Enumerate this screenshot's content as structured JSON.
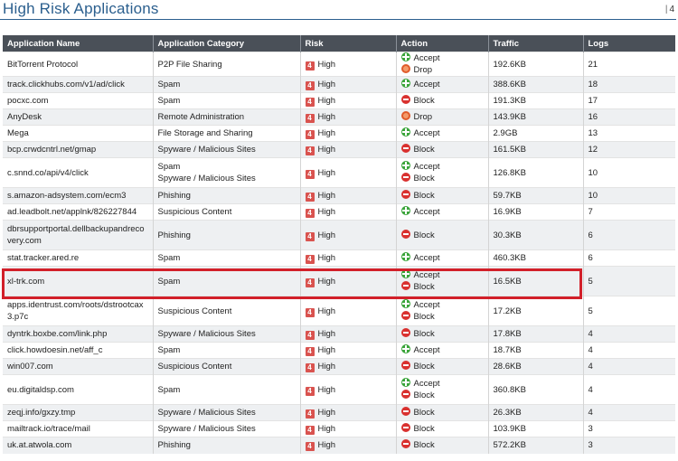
{
  "title": "High Risk Applications",
  "page_number": "4",
  "colors": {
    "title": "#2b5f8e",
    "header_bg": "#4a5058",
    "risk": "#d9534f",
    "accept": "#3aa43a",
    "drop": "#e05a2a",
    "block": "#d9312f",
    "highlight": "#d2202a"
  },
  "columns": [
    "Application Name",
    "Application Category",
    "Risk",
    "Action",
    "Traffic",
    "Logs"
  ],
  "rows": [
    {
      "name": "BitTorrent Protocol",
      "category": "P2P File Sharing",
      "risk_num": "4",
      "risk": "High",
      "actions": [
        {
          "icon": "accept-icon",
          "label": "Accept"
        },
        {
          "icon": "drop-icon",
          "label": "Drop"
        }
      ],
      "traffic": "192.6KB",
      "logs": "21"
    },
    {
      "name": "track.clickhubs.com/v1/ad/click",
      "category": "Spam",
      "risk_num": "4",
      "risk": "High",
      "actions": [
        {
          "icon": "accept-icon",
          "label": "Accept"
        }
      ],
      "traffic": "388.6KB",
      "logs": "18"
    },
    {
      "name": "pocxc.com",
      "category": "Spam",
      "risk_num": "4",
      "risk": "High",
      "actions": [
        {
          "icon": "block-icon",
          "label": "Block"
        }
      ],
      "traffic": "191.3KB",
      "logs": "17"
    },
    {
      "name": "AnyDesk",
      "category": "Remote Administration",
      "risk_num": "4",
      "risk": "High",
      "actions": [
        {
          "icon": "drop-icon",
          "label": "Drop"
        }
      ],
      "traffic": "143.9KB",
      "logs": "16"
    },
    {
      "name": "Mega",
      "category": "File Storage and Sharing",
      "risk_num": "4",
      "risk": "High",
      "actions": [
        {
          "icon": "accept-icon",
          "label": "Accept"
        }
      ],
      "traffic": "2.9GB",
      "logs": "13"
    },
    {
      "name": "bcp.crwdcntrl.net/gmap",
      "category": "Spyware / Malicious Sites",
      "risk_num": "4",
      "risk": "High",
      "actions": [
        {
          "icon": "block-icon",
          "label": "Block"
        }
      ],
      "traffic": "161.5KB",
      "logs": "12"
    },
    {
      "name": "c.snnd.co/api/v4/click",
      "category": "Spam\nSpyware / Malicious Sites",
      "risk_num": "4",
      "risk": "High",
      "actions": [
        {
          "icon": "accept-icon",
          "label": "Accept"
        },
        {
          "icon": "block-icon",
          "label": "Block"
        }
      ],
      "traffic": "126.8KB",
      "logs": "10"
    },
    {
      "name": "s.amazon-adsystem.com/ecm3",
      "category": "Phishing",
      "risk_num": "4",
      "risk": "High",
      "actions": [
        {
          "icon": "block-icon",
          "label": "Block"
        }
      ],
      "traffic": "59.7KB",
      "logs": "10"
    },
    {
      "name": "ad.leadbolt.net/applnk/826227844",
      "category": "Suspicious Content",
      "risk_num": "4",
      "risk": "High",
      "actions": [
        {
          "icon": "accept-icon",
          "label": "Accept"
        }
      ],
      "traffic": "16.9KB",
      "logs": "7"
    },
    {
      "name": "dbrsupportportal.dellbackupandrecovery.com",
      "category": "Phishing",
      "risk_num": "4",
      "risk": "High",
      "actions": [
        {
          "icon": "block-icon",
          "label": "Block"
        }
      ],
      "traffic": "30.3KB",
      "logs": "6"
    },
    {
      "name": "stat.tracker.ared.re",
      "category": "Spam",
      "risk_num": "4",
      "risk": "High",
      "actions": [
        {
          "icon": "accept-icon",
          "label": "Accept"
        }
      ],
      "traffic": "460.3KB",
      "logs": "6"
    },
    {
      "name": "xl-trk.com",
      "category": "Spam",
      "risk_num": "4",
      "risk": "High",
      "actions": [
        {
          "icon": "accept-icon",
          "label": "Accept"
        },
        {
          "icon": "block-icon",
          "label": "Block"
        }
      ],
      "traffic": "16.5KB",
      "logs": "5",
      "highlighted": true
    },
    {
      "name": "apps.identrust.com/roots/dstrootcax3.p7c",
      "category": "Suspicious Content",
      "risk_num": "4",
      "risk": "High",
      "actions": [
        {
          "icon": "accept-icon",
          "label": "Accept"
        },
        {
          "icon": "block-icon",
          "label": "Block"
        }
      ],
      "traffic": "17.2KB",
      "logs": "5"
    },
    {
      "name": "dyntrk.boxbe.com/link.php",
      "category": "Spyware / Malicious Sites",
      "risk_num": "4",
      "risk": "High",
      "actions": [
        {
          "icon": "block-icon",
          "label": "Block"
        }
      ],
      "traffic": "17.8KB",
      "logs": "4"
    },
    {
      "name": "click.howdoesin.net/aff_c",
      "category": "Spam",
      "risk_num": "4",
      "risk": "High",
      "actions": [
        {
          "icon": "accept-icon",
          "label": "Accept"
        }
      ],
      "traffic": "18.7KB",
      "logs": "4"
    },
    {
      "name": "win007.com",
      "category": "Suspicious Content",
      "risk_num": "4",
      "risk": "High",
      "actions": [
        {
          "icon": "block-icon",
          "label": "Block"
        }
      ],
      "traffic": "28.6KB",
      "logs": "4"
    },
    {
      "name": "eu.digitaldsp.com",
      "category": "Spam",
      "risk_num": "4",
      "risk": "High",
      "actions": [
        {
          "icon": "accept-icon",
          "label": "Accept"
        },
        {
          "icon": "block-icon",
          "label": "Block"
        }
      ],
      "traffic": "360.8KB",
      "logs": "4"
    },
    {
      "name": "zeqj.info/gxzy.tmp",
      "category": "Spyware / Malicious Sites",
      "risk_num": "4",
      "risk": "High",
      "actions": [
        {
          "icon": "block-icon",
          "label": "Block"
        }
      ],
      "traffic": "26.3KB",
      "logs": "4"
    },
    {
      "name": "mailtrack.io/trace/mail",
      "category": "Spyware / Malicious Sites",
      "risk_num": "4",
      "risk": "High",
      "actions": [
        {
          "icon": "block-icon",
          "label": "Block"
        }
      ],
      "traffic": "103.9KB",
      "logs": "3"
    },
    {
      "name": "uk.at.atwola.com",
      "category": "Phishing",
      "risk_num": "4",
      "risk": "High",
      "actions": [
        {
          "icon": "block-icon",
          "label": "Block"
        }
      ],
      "traffic": "572.2KB",
      "logs": "3"
    }
  ]
}
